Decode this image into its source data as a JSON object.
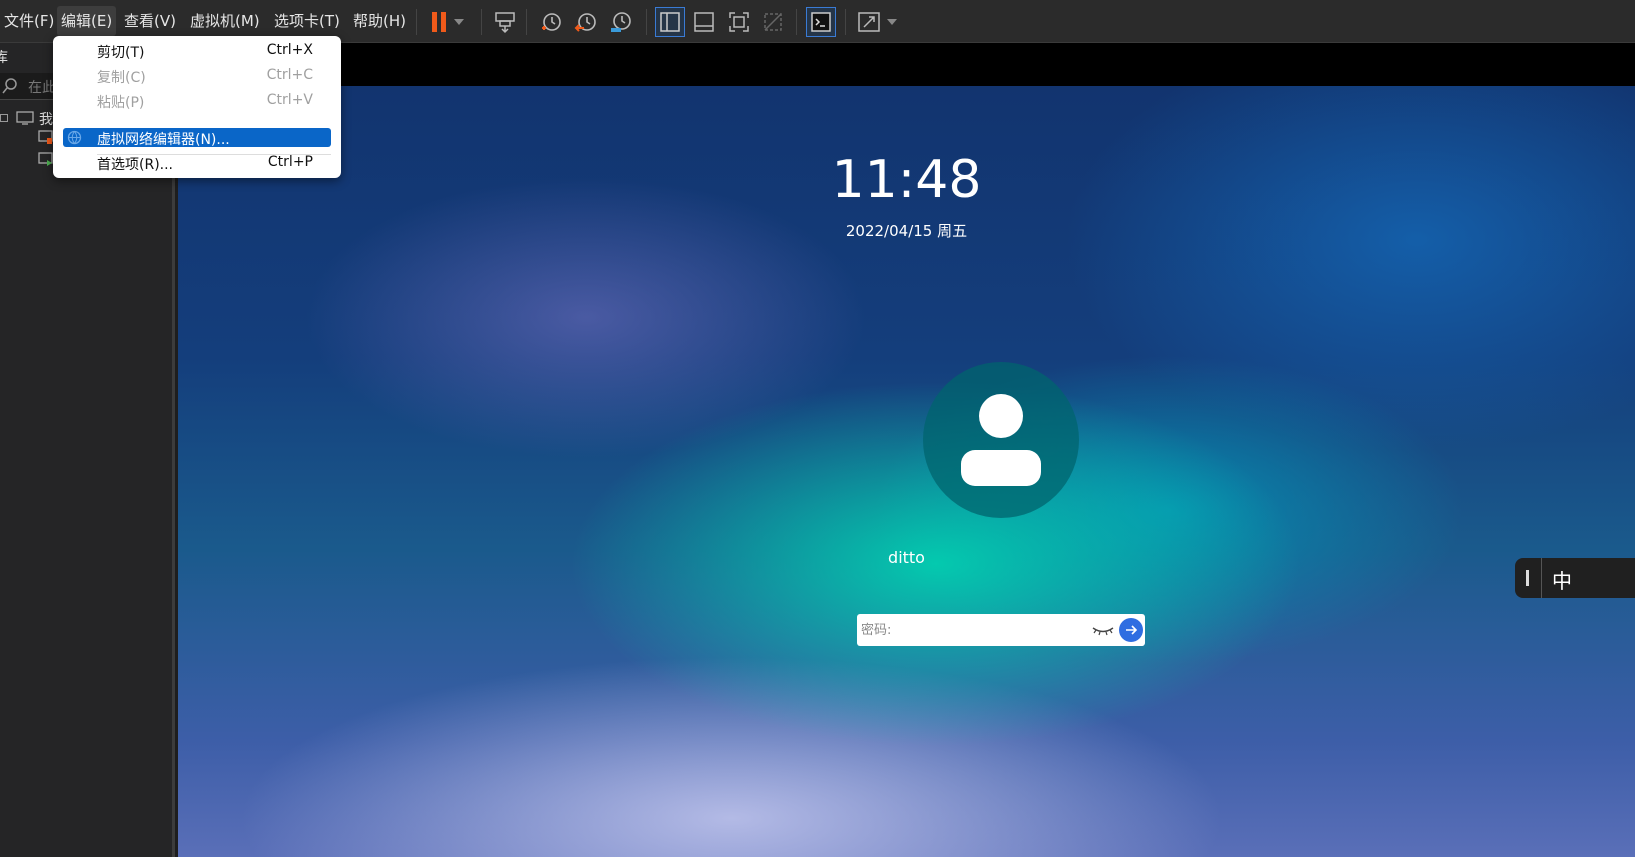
{
  "menubar": {
    "file": "文件(F)",
    "edit": "编辑(E)",
    "view": "查看(V)",
    "vm": "虚拟机(M)",
    "tabs": "选项卡(T)",
    "help": "帮助(H)"
  },
  "toolbar_icons": [
    "pause-icon",
    "dropdown-arrow-icon",
    "send-keys-icon",
    "snapshot-icon",
    "revert-snapshot-icon",
    "snapshot-manager-icon",
    "sidebar-toggle-icon",
    "thumbnail-bar-icon",
    "fullscreen-icon",
    "unity-icon",
    "console-icon",
    "stretch-icon"
  ],
  "library": {
    "title_fragment": "库",
    "search_placeholder": "在此",
    "root_label": "我"
  },
  "edit_menu": {
    "items": [
      {
        "label": "剪切(T)",
        "shortcut": "Ctrl+X",
        "enabled": true
      },
      {
        "label": "复制(C)",
        "shortcut": "Ctrl+C",
        "enabled": false
      },
      {
        "label": "粘贴(P)",
        "shortcut": "Ctrl+V",
        "enabled": false
      },
      {
        "label": "虚拟网络编辑器(N)...",
        "shortcut": "",
        "enabled": true,
        "highlighted": true
      },
      {
        "label": "首选项(R)...",
        "shortcut": "Ctrl+P",
        "enabled": true
      }
    ]
  },
  "lock_screen": {
    "time": "11:48",
    "date": "2022/04/15 周五",
    "username": "ditto",
    "password_placeholder": "密码:",
    "ime_label": "中"
  },
  "colors": {
    "accent": "#0a66c8",
    "pause_orange": "#f05a1a",
    "submit_blue": "#2f6de1"
  }
}
